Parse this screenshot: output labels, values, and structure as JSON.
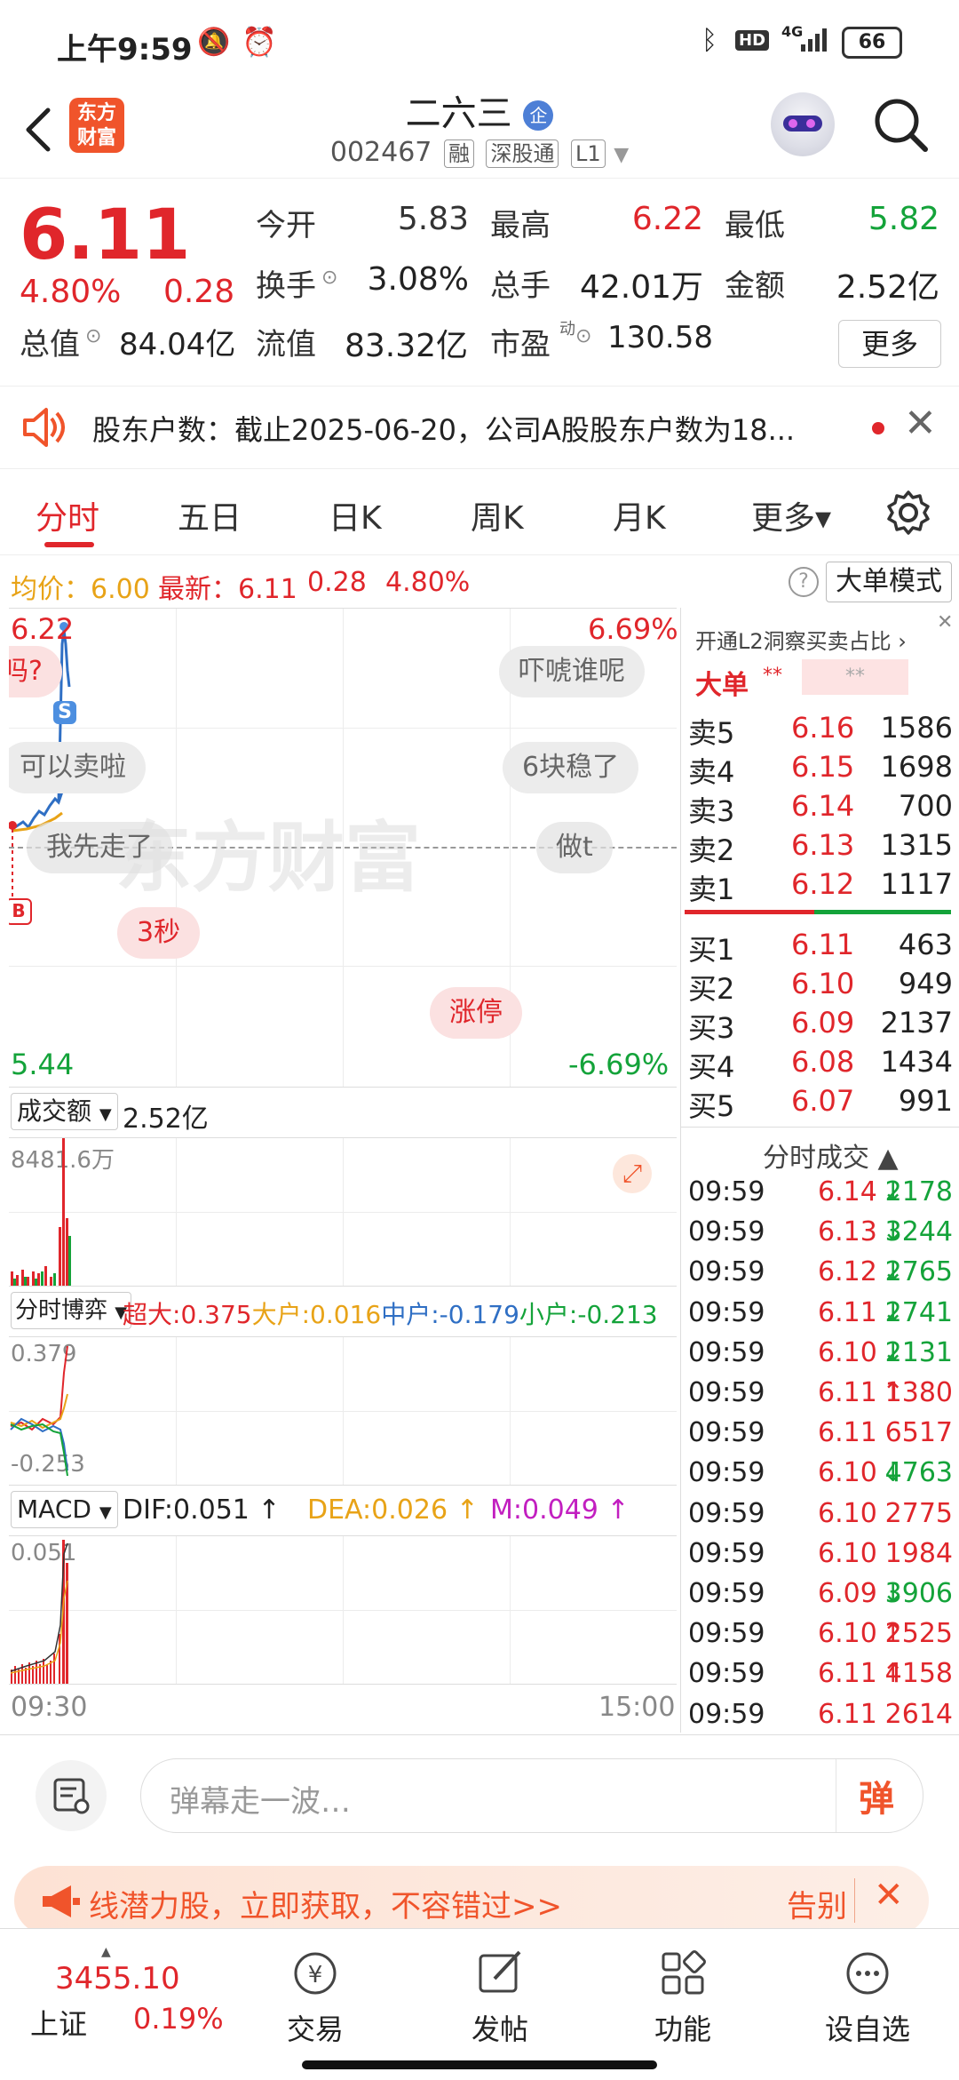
{
  "status_bar": {
    "time": "上午9:59",
    "network": "4G",
    "battery": "66"
  },
  "header": {
    "back_icon": "chevron-left-icon",
    "app_logo": "东方财富",
    "stock_name": "二六三",
    "stock_badge": "企",
    "stock_code": "002467",
    "tags": [
      "融",
      "深股通",
      "L1"
    ],
    "search_icon": "search-icon"
  },
  "quote": {
    "price": "6.11",
    "change_pct": "4.80%",
    "change": "0.28",
    "open_label": "今开",
    "open": "5.83",
    "high_label": "最高",
    "high": "6.22",
    "low_label": "最低",
    "low": "5.82",
    "turnover_label": "换手",
    "turnover": "3.08%",
    "volume_label": "总手",
    "volume": "42.01万",
    "amount_label": "金额",
    "amount": "2.52亿",
    "mcap_label": "总值",
    "mcap": "84.04亿",
    "float_label": "流值",
    "float_cap": "83.32亿",
    "pe_label": "市盈",
    "pe_sup": "动",
    "pe": "130.58",
    "more_button": "更多"
  },
  "notice": {
    "text": "股东户数：截止2025-06-20，公司A股股东户数为18..."
  },
  "tabs": [
    {
      "label": "分时",
      "active": true
    },
    {
      "label": "五日"
    },
    {
      "label": "日K"
    },
    {
      "label": "周K"
    },
    {
      "label": "月K"
    },
    {
      "label": "更多▾"
    }
  ],
  "info_line": {
    "avg_label": "均价：",
    "avg": "6.00",
    "latest_label": "最新：",
    "latest": "6.11",
    "change": "0.28",
    "change_pct": "4.80%",
    "big_order_button": "大单模式"
  },
  "intraday": {
    "y_top": "6.22",
    "y_bottom": "5.44",
    "pct_top": "6.69%",
    "pct_bottom": "-6.69%",
    "marker_s": "S",
    "marker_b": "B",
    "watermark": "东方财富",
    "danmaku": [
      "吗?",
      "吓唬谁呢",
      "可以卖啦",
      "6块稳了",
      "我先走了",
      "做t",
      "3秒",
      "涨停"
    ],
    "time_start": "09:30",
    "time_end": "15:00"
  },
  "volume_panel": {
    "label": "成交额",
    "value": "2.52亿",
    "max": "8481.6万"
  },
  "game_panel": {
    "label": "分时博弈",
    "super_label": "超大:",
    "super": "0.375",
    "big_label": "大户:",
    "big": "0.016",
    "mid_label": "中户:",
    "mid": "-0.179",
    "small_label": "小户:",
    "small": "-0.213",
    "max": "0.379",
    "min": "-0.253"
  },
  "macd_panel": {
    "label": "MACD",
    "dif_label": "DIF:",
    "dif": "0.051",
    "dea_label": "DEA:",
    "dea": "0.026",
    "m_label": "M:",
    "m": "0.049",
    "max": "0.051"
  },
  "orderbook": {
    "promo": "开通L2洞察买卖占比",
    "big_label": "大单",
    "big_value": "**",
    "big_value2": "**",
    "asks": [
      {
        "label": "卖5",
        "price": "6.16",
        "vol": "1586"
      },
      {
        "label": "卖4",
        "price": "6.15",
        "vol": "1698"
      },
      {
        "label": "卖3",
        "price": "6.14",
        "vol": "700"
      },
      {
        "label": "卖2",
        "price": "6.13",
        "vol": "1315"
      },
      {
        "label": "卖1",
        "price": "6.12",
        "vol": "1117"
      }
    ],
    "bids": [
      {
        "label": "买1",
        "price": "6.11",
        "vol": "463"
      },
      {
        "label": "买2",
        "price": "6.10",
        "vol": "949"
      },
      {
        "label": "买3",
        "price": "6.09",
        "vol": "2137"
      },
      {
        "label": "买4",
        "price": "6.08",
        "vol": "1434"
      },
      {
        "label": "买5",
        "price": "6.07",
        "vol": "991"
      }
    ],
    "ticks_title": "分时成交",
    "ticks": [
      {
        "time": "09:59",
        "price": "6.14",
        "dir": "↓",
        "vol": "2178",
        "color": "green"
      },
      {
        "time": "09:59",
        "price": "6.13",
        "dir": "↓",
        "vol": "3244",
        "color": "green"
      },
      {
        "time": "09:59",
        "price": "6.12",
        "dir": "↓",
        "vol": "2765",
        "color": "green"
      },
      {
        "time": "09:59",
        "price": "6.11",
        "dir": "↓",
        "vol": "2741",
        "color": "green"
      },
      {
        "time": "09:59",
        "price": "6.10",
        "dir": "↓",
        "vol": "2131",
        "color": "green"
      },
      {
        "time": "09:59",
        "price": "6.11",
        "dir": "↑",
        "vol": "1380",
        "color": "red"
      },
      {
        "time": "09:59",
        "price": "6.11",
        "dir": "",
        "vol": "6517",
        "color": "red"
      },
      {
        "time": "09:59",
        "price": "6.10",
        "dir": "↓",
        "vol": "4763",
        "color": "green"
      },
      {
        "time": "09:59",
        "price": "6.10",
        "dir": "",
        "vol": "2775",
        "color": "red"
      },
      {
        "time": "09:59",
        "price": "6.10",
        "dir": "",
        "vol": "1984",
        "color": "red"
      },
      {
        "time": "09:59",
        "price": "6.09",
        "dir": "↓",
        "vol": "3906",
        "color": "green"
      },
      {
        "time": "09:59",
        "price": "6.10",
        "dir": "↑",
        "vol": "2525",
        "color": "red"
      },
      {
        "time": "09:59",
        "price": "6.11",
        "dir": "↑",
        "vol": "4158",
        "color": "red"
      },
      {
        "time": "09:59",
        "price": "6.11",
        "dir": "",
        "vol": "2614",
        "color": "red"
      }
    ]
  },
  "comment_bar": {
    "placeholder": "弹幕走一波…",
    "danmaku_button": "弹"
  },
  "ad_banner": {
    "text": "线潜力股，立即获取，不容错过>>",
    "right": "告别"
  },
  "bottom_nav": {
    "index_value": "3455.10",
    "index_name": "上证",
    "index_pct": "0.19%",
    "items": [
      {
        "label": "交易",
        "icon": "yuan-cycle-icon"
      },
      {
        "label": "发帖",
        "icon": "edit-icon"
      },
      {
        "label": "功能",
        "icon": "grid-icon"
      },
      {
        "label": "设自选",
        "icon": "more-circle-icon"
      }
    ]
  },
  "colors": {
    "up": "#e0262b",
    "down": "#14a33a",
    "avg_line": "#e8a317",
    "price_line": "#2f6fc4",
    "super": "#e0262b",
    "big": "#e8a317",
    "mid": "#2f6fc4",
    "small": "#14a33a",
    "dea": "#e8a317",
    "m": "#c21fc0"
  }
}
